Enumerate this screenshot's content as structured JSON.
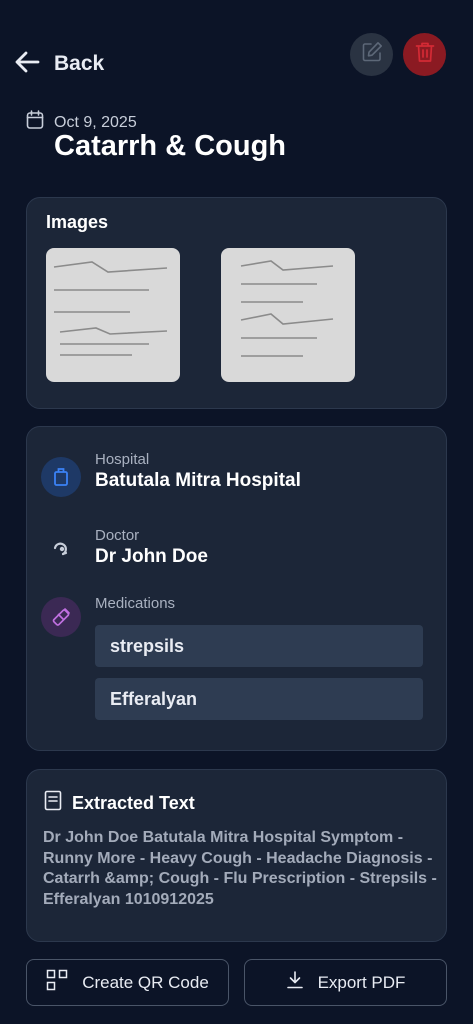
{
  "header": {
    "back_label": "Back",
    "back_icon": "arrow-left-icon",
    "edit_icon": "pencil-icon",
    "delete_icon": "trash-icon"
  },
  "record": {
    "date": "Oct 9, 2025",
    "title": "Catarrh & Cough"
  },
  "images": {
    "heading": "Images"
  },
  "info": {
    "hospital_label": "Hospital",
    "hospital_value": "Batutala Mitra Hospital",
    "doctor_label": "Doctor",
    "doctor_value": "Dr John Doe",
    "medications_label": "Medications",
    "medications": [
      "strepsils",
      "Efferalyan"
    ]
  },
  "extracted": {
    "heading": "Extracted Text",
    "text": "Dr John Doe Batutala Mitra Hospital Symptom - Runny More - Heavy Cough - Headache Diagnosis - Catarrh &amp; Cough - Flu Prescription - Strepsils - Efferalyan 1010912025"
  },
  "actions": {
    "qr_label": "Create QR Code",
    "pdf_label": "Export PDF"
  },
  "colors": {
    "background": "#0c1427",
    "card": "#1c2638",
    "delete_red": "#8b1a22",
    "hospital_blue": "#3b82f6",
    "medication_purple": "#c070e0"
  }
}
